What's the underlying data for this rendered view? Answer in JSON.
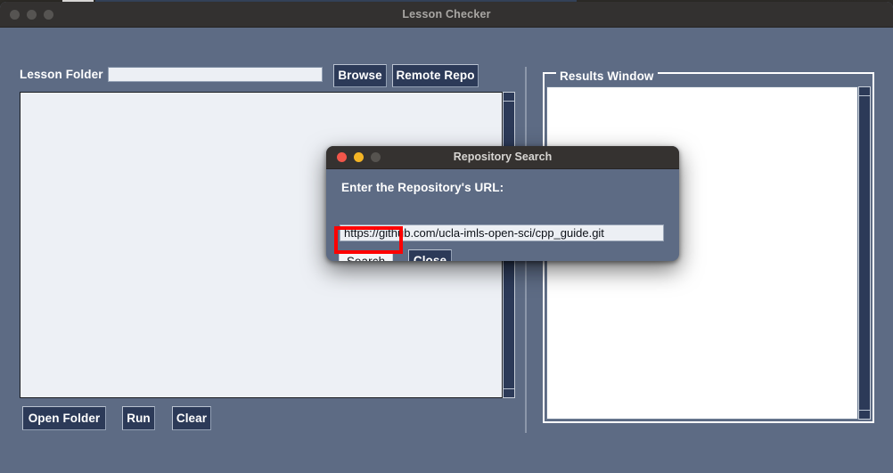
{
  "window": {
    "title": "Lesson Checker",
    "traffic_lights": [
      "inactive",
      "inactive",
      "inactive"
    ]
  },
  "toolbar": {
    "lesson_folder_label": "Lesson Folder",
    "lesson_folder_value": "",
    "lesson_folder_placeholder": "",
    "browse_label": "Browse",
    "remote_repo_label": "Remote Repo"
  },
  "main_panel": {
    "textarea_value": ""
  },
  "actions": {
    "open_folder_label": "Open Folder",
    "run_label": "Run",
    "clear_label": "Clear"
  },
  "results": {
    "group_label": "Results Window",
    "textarea_value": ""
  },
  "dialog": {
    "title": "Repository Search",
    "traffic_lights": [
      "red",
      "yellow",
      "gray"
    ],
    "prompt_label": "Enter the Repository's URL:",
    "url_value": "https://github.com/ucla-imls-open-sci/cpp_guide.git",
    "url_placeholder": "",
    "search_label": "Search",
    "close_label": "Close"
  },
  "annotation": {
    "highlight_color": "#ff0000",
    "target": "search-button"
  },
  "colors": {
    "window_bg": "#5d6b84",
    "titlebar": "#333130",
    "button_bg": "#2c3a58",
    "field_bg": "#eceff4",
    "results_bg": "#ffffff",
    "scrollbar_thumb": "#2c3a58"
  }
}
